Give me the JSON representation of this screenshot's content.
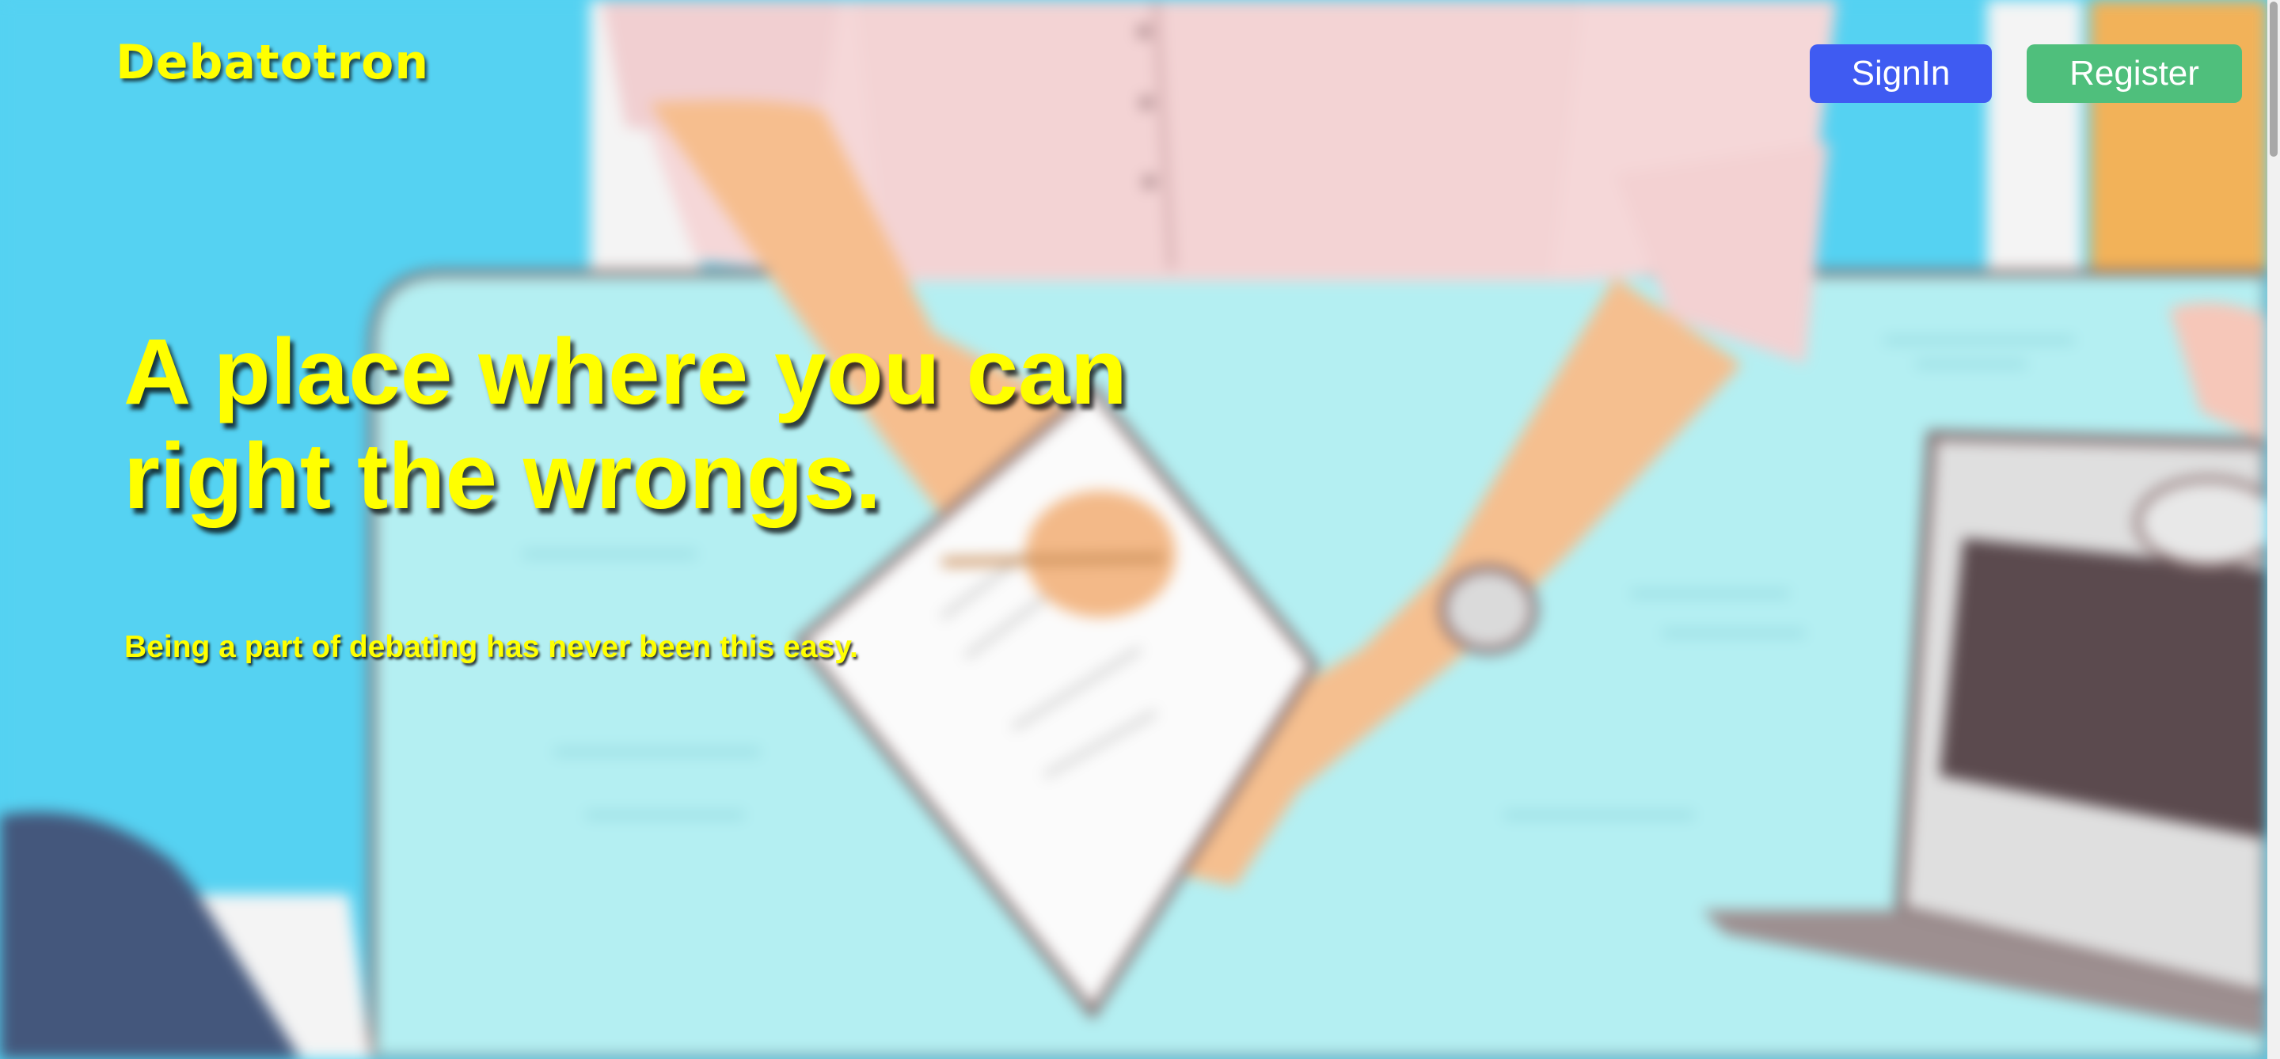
{
  "header": {
    "logo": "Debatotron",
    "signin_label": "SignIn",
    "register_label": "Register"
  },
  "hero": {
    "title": "A place where you can right the wrongs.",
    "subtitle": "Being a part of debating has never been this easy."
  },
  "colors": {
    "accent_text": "#ffff00",
    "signin_button": "#3f5bf2",
    "register_button": "#4fbf7c",
    "background_wall": "#55d2f2",
    "table_surface": "#b3eef2"
  },
  "background_image": "blurred illustration of a person in a pink shirt writing on paper at a light blue table with a laptop"
}
